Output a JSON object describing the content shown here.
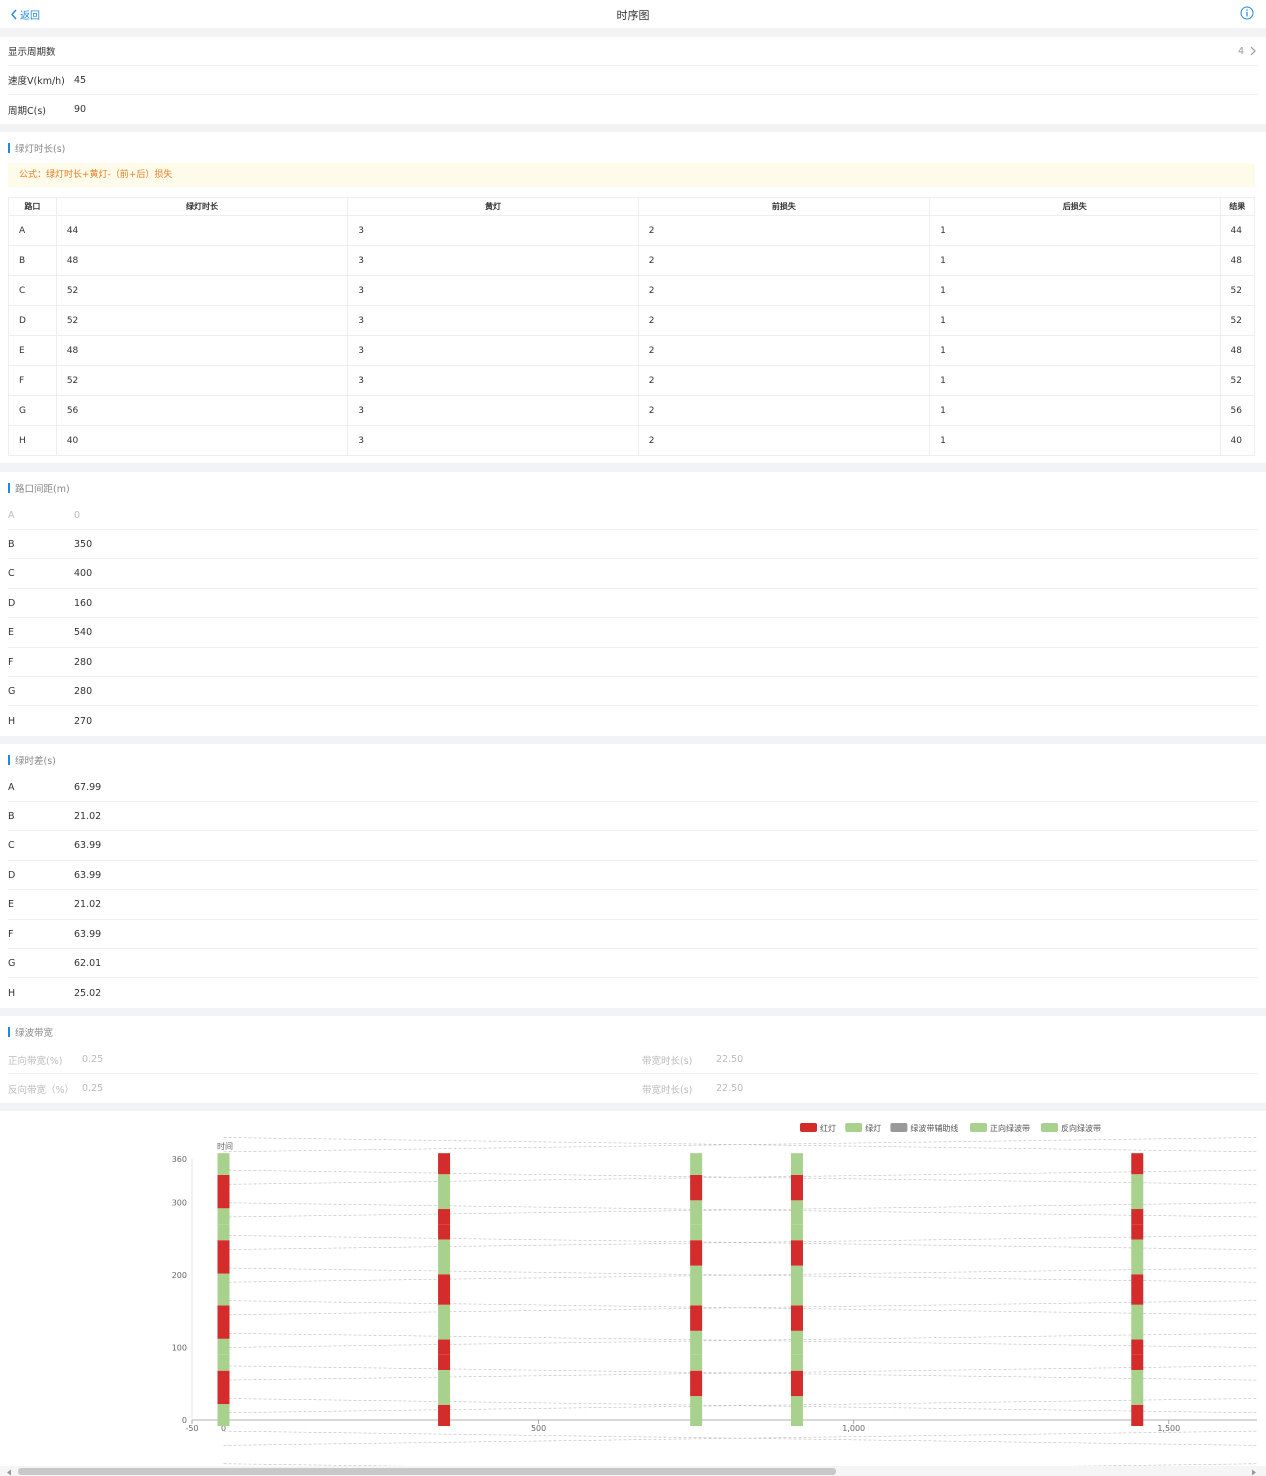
{
  "header": {
    "back_label": "返回",
    "title": "时序图"
  },
  "settings": [
    {
      "label": "显示周期数",
      "value": "4"
    },
    {
      "label": "速度V(km/h)",
      "value": "45"
    },
    {
      "label": "周期C(s)",
      "value": "90"
    }
  ],
  "green": {
    "section_title": "绿灯时长(s)",
    "formula": "公式：绿灯时长+黄灯-（前+后）损失",
    "headers": [
      "路口",
      "绿灯时长",
      "黄灯",
      "前损失",
      "后损失",
      "结果"
    ],
    "rows": [
      [
        "A",
        "44",
        "3",
        "2",
        "1",
        "44"
      ],
      [
        "B",
        "48",
        "3",
        "2",
        "1",
        "48"
      ],
      [
        "C",
        "52",
        "3",
        "2",
        "1",
        "52"
      ],
      [
        "D",
        "52",
        "3",
        "2",
        "1",
        "52"
      ],
      [
        "E",
        "48",
        "3",
        "2",
        "1",
        "48"
      ],
      [
        "F",
        "52",
        "3",
        "2",
        "1",
        "52"
      ],
      [
        "G",
        "56",
        "3",
        "2",
        "1",
        "56"
      ],
      [
        "H",
        "40",
        "3",
        "2",
        "1",
        "40"
      ]
    ]
  },
  "distance": {
    "section_title": "路口间距(m)",
    "rows": [
      [
        "A",
        "0"
      ],
      [
        "B",
        "350"
      ],
      [
        "C",
        "400"
      ],
      [
        "D",
        "160"
      ],
      [
        "E",
        "540"
      ],
      [
        "F",
        "280"
      ],
      [
        "G",
        "280"
      ],
      [
        "H",
        "270"
      ]
    ]
  },
  "offset": {
    "section_title": "绿时差(s)",
    "rows": [
      [
        "A",
        "67.99"
      ],
      [
        "B",
        "21.02"
      ],
      [
        "C",
        "63.99"
      ],
      [
        "D",
        "63.99"
      ],
      [
        "E",
        "21.02"
      ],
      [
        "F",
        "63.99"
      ],
      [
        "G",
        "62.01"
      ],
      [
        "H",
        "25.02"
      ]
    ]
  },
  "bandwidth": {
    "section_title": "绿波带宽",
    "forward_label": "正向带宽(%)",
    "forward_value": "0.25",
    "forward_time_label": "带宽时长(s)",
    "forward_time_value": "22.50",
    "reverse_label": "反向带宽（%）",
    "reverse_value": "0.25",
    "reverse_time_label": "带宽时长(s)",
    "reverse_time_value": "22.50"
  },
  "chart_data": {
    "type": "timing-space",
    "ylabel": "时间",
    "xlim": [
      -50,
      1640
    ],
    "ylim": [
      0,
      360
    ],
    "x_ticks": [
      -50,
      0,
      500,
      1000,
      1500
    ],
    "x_tick_labels": [
      "-50",
      "0",
      "500",
      "1,000",
      "1,500"
    ],
    "y_ticks": [
      0,
      100,
      200,
      300,
      360
    ],
    "legend": [
      {
        "name": "红灯",
        "color": "#d42b2b"
      },
      {
        "name": "绿灯",
        "color": "#a9d18e"
      },
      {
        "name": "绿波带辅助线",
        "color": "#999999"
      },
      {
        "name": "正向绿波带",
        "color": "#a9d18e"
      },
      {
        "name": "反向绿波带",
        "color": "#a9d18e"
      }
    ],
    "legend_position": "top-right",
    "colors": {
      "red": "#d42b2b",
      "green": "#a9d18e",
      "line": "#bbbbbb"
    },
    "signals": [
      {
        "x": 0,
        "cycle": 90,
        "segments": [
          [
            0,
            22,
            "green"
          ],
          [
            22,
            68,
            "red"
          ],
          [
            68,
            90,
            "green"
          ]
        ]
      },
      {
        "x": 350,
        "cycle": 90,
        "segments": [
          [
            0,
            21,
            "red"
          ],
          [
            21,
            69,
            "green"
          ],
          [
            69,
            90,
            "red"
          ]
        ]
      },
      {
        "x": 750,
        "cycle": 90,
        "segments": [
          [
            0,
            33,
            "green"
          ],
          [
            33,
            68,
            "red"
          ],
          [
            68,
            90,
            "green"
          ]
        ]
      },
      {
        "x": 910,
        "cycle": 90,
        "segments": [
          [
            0,
            33,
            "green"
          ],
          [
            33,
            68,
            "red"
          ],
          [
            68,
            90,
            "green"
          ]
        ]
      },
      {
        "x": 1450,
        "cycle": 90,
        "segments": [
          [
            0,
            21,
            "red"
          ],
          [
            21,
            69,
            "green"
          ],
          [
            69,
            90,
            "red"
          ]
        ]
      }
    ]
  }
}
